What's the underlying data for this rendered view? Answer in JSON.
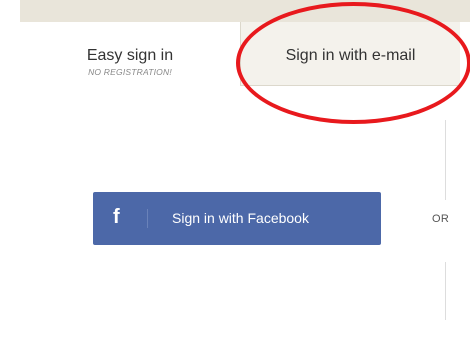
{
  "tabs": {
    "easy_sign_in": {
      "label": "Easy sign in",
      "sublabel": "NO REGISTRATION!"
    },
    "email_sign_in": {
      "label": "Sign in with e-mail"
    }
  },
  "facebook_button": {
    "icon": "f",
    "label": "Sign in with Facebook",
    "color": "#4c68a8"
  },
  "separator": {
    "label": "OR"
  },
  "annotation": {
    "color": "#e8191d"
  }
}
